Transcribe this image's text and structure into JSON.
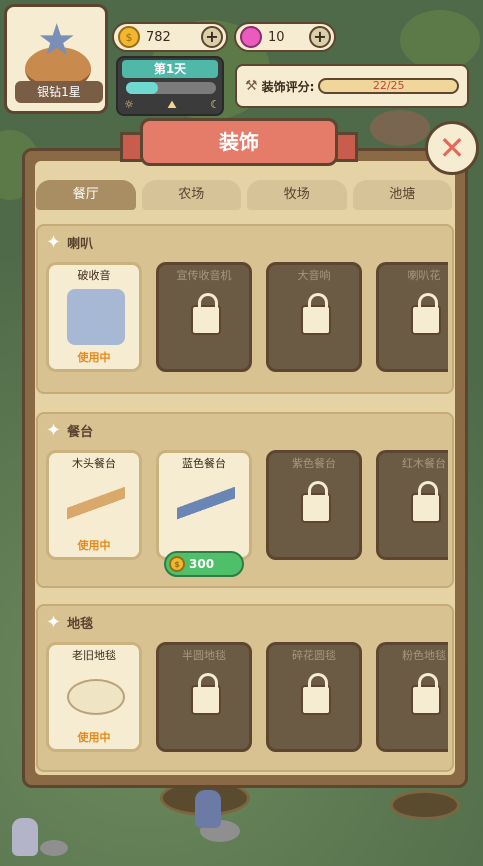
{
  "player": {
    "level_label": "银钻1星"
  },
  "currency": {
    "coins": "782",
    "gems": "10"
  },
  "day": {
    "label": "第1天",
    "progress": 0.35
  },
  "score": {
    "label": "装饰评分:",
    "value": "22/25"
  },
  "panel": {
    "title": "装饰"
  },
  "tabs": [
    {
      "label": "餐厅",
      "active": true
    },
    {
      "label": "农场",
      "active": false
    },
    {
      "label": "牧场",
      "active": false
    },
    {
      "label": "池塘",
      "active": false
    }
  ],
  "sections": [
    {
      "title": "喇叭",
      "items": [
        {
          "name": "破收音",
          "status": "使用中"
        },
        {
          "name": "宣传收音机",
          "status": ""
        },
        {
          "name": "大音响",
          "status": ""
        },
        {
          "name": "喇叭花",
          "status": ""
        }
      ]
    },
    {
      "title": "餐台",
      "items": [
        {
          "name": "木头餐台",
          "status": "使用中"
        },
        {
          "name": "蓝色餐台",
          "status": ""
        },
        {
          "name": "紫色餐台",
          "status": ""
        },
        {
          "name": "红木餐台",
          "status": ""
        }
      ]
    },
    {
      "title": "地毯",
      "items": [
        {
          "name": "老旧地毯",
          "status": "使用中"
        },
        {
          "name": "半圆地毯",
          "status": ""
        },
        {
          "name": "碎花圆毯",
          "status": ""
        },
        {
          "name": "粉色地毯",
          "status": ""
        }
      ]
    }
  ],
  "price": {
    "value": "300"
  },
  "colors": {
    "accent": "#e57b69",
    "panel": "#8a6a44",
    "green": "#4fbf6a"
  }
}
